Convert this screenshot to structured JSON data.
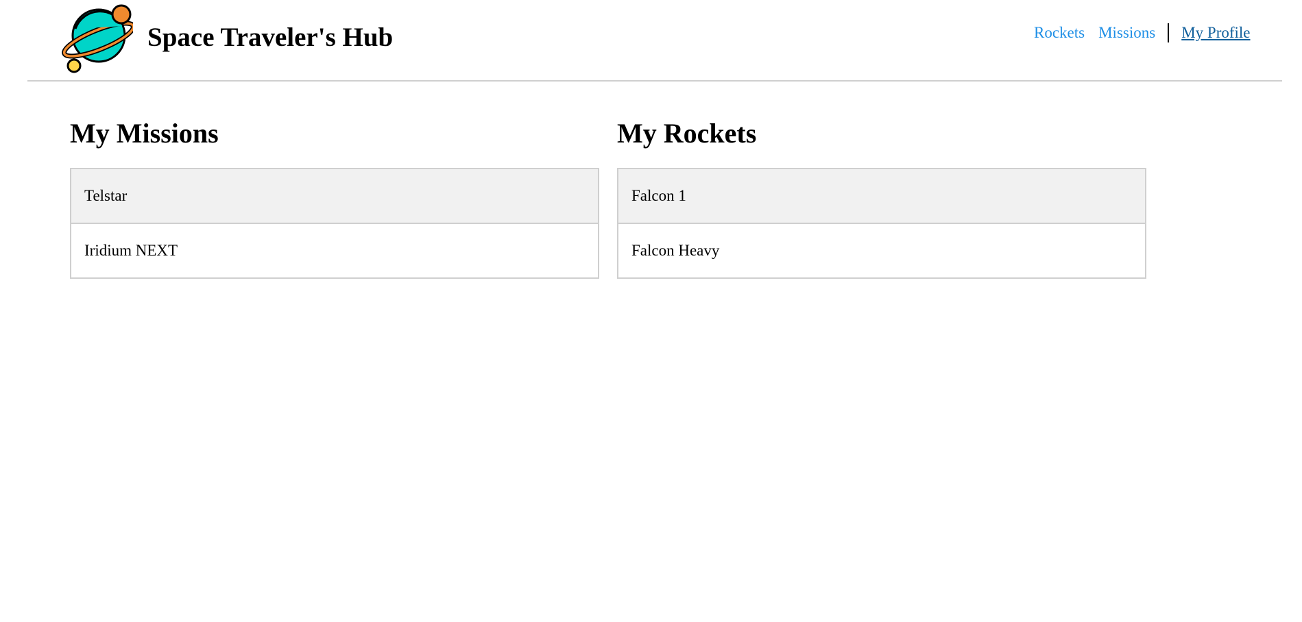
{
  "header": {
    "brand_title": "Space Traveler's Hub",
    "logo_icon": "planet-icon",
    "colors": {
      "planet": "#00d4c8",
      "moon": "#f08a2e",
      "small_moon": "#ffd54a",
      "outline": "#000000"
    }
  },
  "nav": {
    "items": [
      {
        "label": "Rockets",
        "active": false
      },
      {
        "label": "Missions",
        "active": false
      },
      {
        "label": "My Profile",
        "active": true
      }
    ],
    "link_color": "#1f8fe6",
    "active_color": "#12609c"
  },
  "missions": {
    "title": "My Missions",
    "items": [
      "Telstar",
      "Iridium NEXT"
    ]
  },
  "rockets": {
    "title": "My Rockets",
    "items": [
      "Falcon 1",
      "Falcon Heavy"
    ]
  }
}
